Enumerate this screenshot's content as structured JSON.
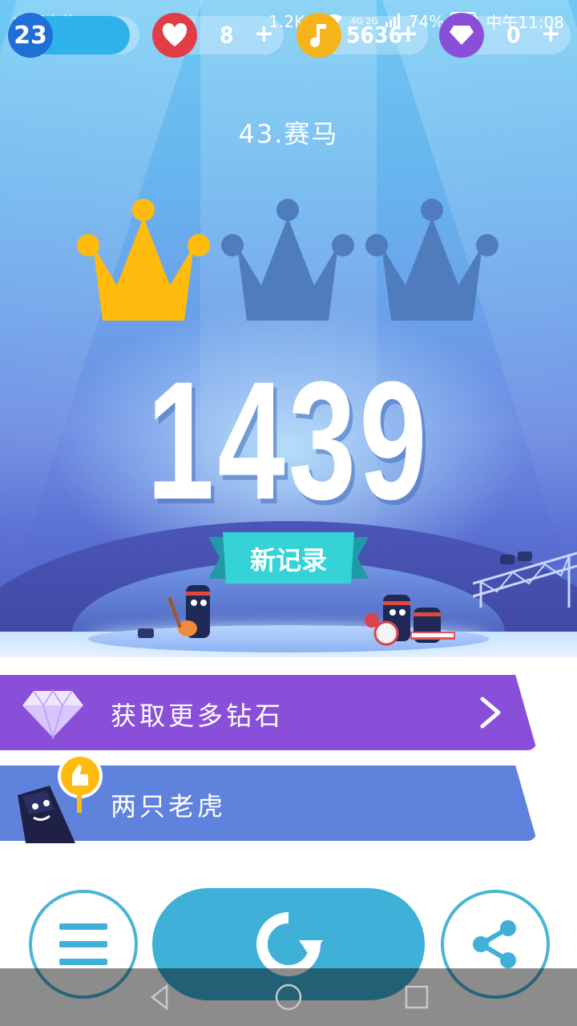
{
  "status_bar": {
    "carrier": "中国电信",
    "net_speed": "1.2K/s",
    "network": "4G 2G",
    "battery": "74%",
    "time": "中午11:08"
  },
  "resources": {
    "level": "23",
    "lives": "8",
    "notes": "5636",
    "diamonds": "0",
    "plus": "+"
  },
  "song": {
    "title": "43.赛马"
  },
  "result": {
    "crowns_earned": 1,
    "crowns_total": 3,
    "score": "1439",
    "new_record": "新记录"
  },
  "banners": {
    "diamonds": "获取更多钻石",
    "next_song": "两只老虎"
  },
  "colors": {
    "crown_gold": "#ffbb0e",
    "crown_dim": "#4f7cbd",
    "banner_purple": "#8a4fd9",
    "banner_blue": "#5f83dd",
    "accent": "#3fb0d8"
  }
}
